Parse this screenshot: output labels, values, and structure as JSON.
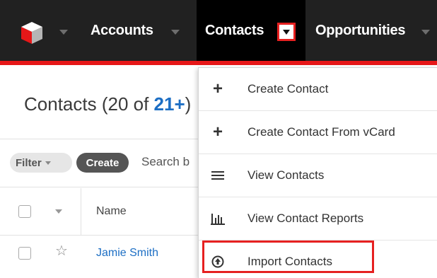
{
  "nav": {
    "items": [
      {
        "label": "Accounts"
      },
      {
        "label": "Contacts"
      },
      {
        "label": "Opportunities"
      }
    ],
    "accent_color": "#e61718",
    "active": "Contacts"
  },
  "page": {
    "title_prefix": "Contacts (20 of ",
    "title_count": "21+",
    "title_suffix": ")"
  },
  "toolbar": {
    "filter_label": "Filter",
    "create_label": "Create",
    "search_placeholder_partial": "Search b"
  },
  "table": {
    "columns": [
      "Name"
    ],
    "rows": [
      {
        "name": "Jamie Smith"
      }
    ]
  },
  "menu": {
    "items": [
      {
        "label": "Create Contact",
        "icon": "plus-icon"
      },
      {
        "label": "Create Contact From vCard",
        "icon": "plus-icon"
      },
      {
        "label": "View Contacts",
        "icon": "list-icon"
      },
      {
        "label": "View Contact Reports",
        "icon": "bar-chart-icon"
      },
      {
        "label": "Import Contacts",
        "icon": "upload-icon"
      }
    ],
    "highlight_color": "#e62020"
  }
}
